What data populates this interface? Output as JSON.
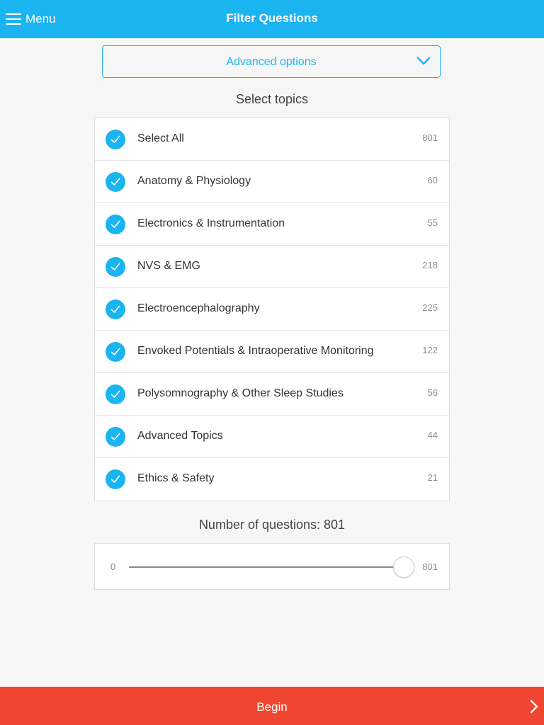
{
  "header": {
    "menu_label": "Menu",
    "title": "Filter Questions"
  },
  "advanced_options": {
    "label": "Advanced options"
  },
  "topics": {
    "title": "Select topics",
    "items": [
      {
        "label": "Select All",
        "count": "801",
        "checked": true
      },
      {
        "label": "Anatomy & Physiology",
        "count": "60",
        "checked": true
      },
      {
        "label": "Electronics & Instrumentation",
        "count": "55",
        "checked": true
      },
      {
        "label": "NVS & EMG",
        "count": "218",
        "checked": true
      },
      {
        "label": "Electroencephalography",
        "count": "225",
        "checked": true
      },
      {
        "label": "Envoked Potentials & Intraoperative Monitoring",
        "count": "122",
        "checked": true
      },
      {
        "label": "Polysomnography & Other Sleep Studies",
        "count": "56",
        "checked": true
      },
      {
        "label": "Advanced Topics",
        "count": "44",
        "checked": true
      },
      {
        "label": "Ethics & Safety",
        "count": "21",
        "checked": true
      }
    ]
  },
  "question_count": {
    "title": "Number of questions: 801",
    "min_label": "0",
    "max_label": "801",
    "min": 0,
    "max": 801,
    "value": 801
  },
  "begin": {
    "label": "Begin"
  },
  "colors": {
    "accent": "#1ab4f0",
    "begin": "#f04631",
    "background": "#f6f6f6"
  },
  "icons": {
    "menu": "hamburger-icon",
    "dropdown": "chevron-down-icon",
    "check": "checkmark-icon",
    "begin": "chevron-right-icon"
  }
}
